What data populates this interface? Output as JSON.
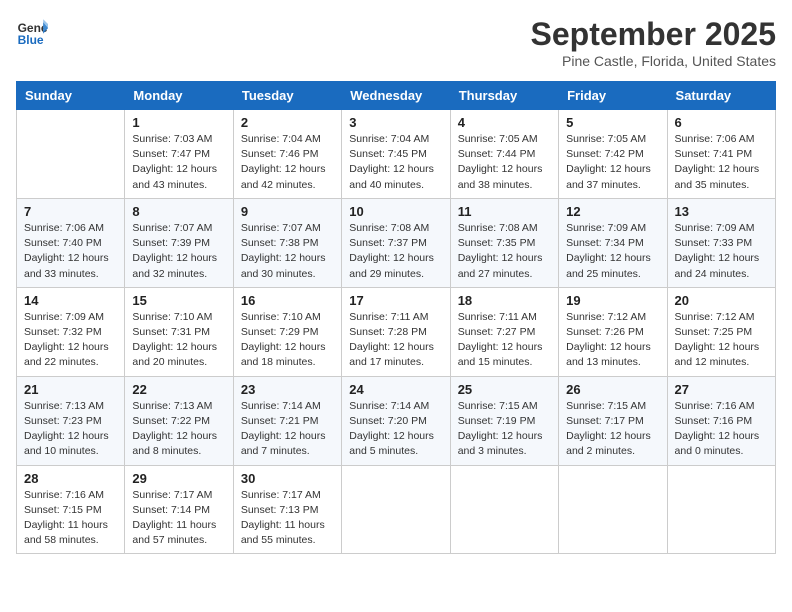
{
  "header": {
    "logo_line1": "General",
    "logo_line2": "Blue",
    "month": "September 2025",
    "location": "Pine Castle, Florida, United States"
  },
  "weekdays": [
    "Sunday",
    "Monday",
    "Tuesday",
    "Wednesday",
    "Thursday",
    "Friday",
    "Saturday"
  ],
  "weeks": [
    [
      {
        "day": "",
        "info": ""
      },
      {
        "day": "1",
        "info": "Sunrise: 7:03 AM\nSunset: 7:47 PM\nDaylight: 12 hours\nand 43 minutes."
      },
      {
        "day": "2",
        "info": "Sunrise: 7:04 AM\nSunset: 7:46 PM\nDaylight: 12 hours\nand 42 minutes."
      },
      {
        "day": "3",
        "info": "Sunrise: 7:04 AM\nSunset: 7:45 PM\nDaylight: 12 hours\nand 40 minutes."
      },
      {
        "day": "4",
        "info": "Sunrise: 7:05 AM\nSunset: 7:44 PM\nDaylight: 12 hours\nand 38 minutes."
      },
      {
        "day": "5",
        "info": "Sunrise: 7:05 AM\nSunset: 7:42 PM\nDaylight: 12 hours\nand 37 minutes."
      },
      {
        "day": "6",
        "info": "Sunrise: 7:06 AM\nSunset: 7:41 PM\nDaylight: 12 hours\nand 35 minutes."
      }
    ],
    [
      {
        "day": "7",
        "info": "Sunrise: 7:06 AM\nSunset: 7:40 PM\nDaylight: 12 hours\nand 33 minutes."
      },
      {
        "day": "8",
        "info": "Sunrise: 7:07 AM\nSunset: 7:39 PM\nDaylight: 12 hours\nand 32 minutes."
      },
      {
        "day": "9",
        "info": "Sunrise: 7:07 AM\nSunset: 7:38 PM\nDaylight: 12 hours\nand 30 minutes."
      },
      {
        "day": "10",
        "info": "Sunrise: 7:08 AM\nSunset: 7:37 PM\nDaylight: 12 hours\nand 29 minutes."
      },
      {
        "day": "11",
        "info": "Sunrise: 7:08 AM\nSunset: 7:35 PM\nDaylight: 12 hours\nand 27 minutes."
      },
      {
        "day": "12",
        "info": "Sunrise: 7:09 AM\nSunset: 7:34 PM\nDaylight: 12 hours\nand 25 minutes."
      },
      {
        "day": "13",
        "info": "Sunrise: 7:09 AM\nSunset: 7:33 PM\nDaylight: 12 hours\nand 24 minutes."
      }
    ],
    [
      {
        "day": "14",
        "info": "Sunrise: 7:09 AM\nSunset: 7:32 PM\nDaylight: 12 hours\nand 22 minutes."
      },
      {
        "day": "15",
        "info": "Sunrise: 7:10 AM\nSunset: 7:31 PM\nDaylight: 12 hours\nand 20 minutes."
      },
      {
        "day": "16",
        "info": "Sunrise: 7:10 AM\nSunset: 7:29 PM\nDaylight: 12 hours\nand 18 minutes."
      },
      {
        "day": "17",
        "info": "Sunrise: 7:11 AM\nSunset: 7:28 PM\nDaylight: 12 hours\nand 17 minutes."
      },
      {
        "day": "18",
        "info": "Sunrise: 7:11 AM\nSunset: 7:27 PM\nDaylight: 12 hours\nand 15 minutes."
      },
      {
        "day": "19",
        "info": "Sunrise: 7:12 AM\nSunset: 7:26 PM\nDaylight: 12 hours\nand 13 minutes."
      },
      {
        "day": "20",
        "info": "Sunrise: 7:12 AM\nSunset: 7:25 PM\nDaylight: 12 hours\nand 12 minutes."
      }
    ],
    [
      {
        "day": "21",
        "info": "Sunrise: 7:13 AM\nSunset: 7:23 PM\nDaylight: 12 hours\nand 10 minutes."
      },
      {
        "day": "22",
        "info": "Sunrise: 7:13 AM\nSunset: 7:22 PM\nDaylight: 12 hours\nand 8 minutes."
      },
      {
        "day": "23",
        "info": "Sunrise: 7:14 AM\nSunset: 7:21 PM\nDaylight: 12 hours\nand 7 minutes."
      },
      {
        "day": "24",
        "info": "Sunrise: 7:14 AM\nSunset: 7:20 PM\nDaylight: 12 hours\nand 5 minutes."
      },
      {
        "day": "25",
        "info": "Sunrise: 7:15 AM\nSunset: 7:19 PM\nDaylight: 12 hours\nand 3 minutes."
      },
      {
        "day": "26",
        "info": "Sunrise: 7:15 AM\nSunset: 7:17 PM\nDaylight: 12 hours\nand 2 minutes."
      },
      {
        "day": "27",
        "info": "Sunrise: 7:16 AM\nSunset: 7:16 PM\nDaylight: 12 hours\nand 0 minutes."
      }
    ],
    [
      {
        "day": "28",
        "info": "Sunrise: 7:16 AM\nSunset: 7:15 PM\nDaylight: 11 hours\nand 58 minutes."
      },
      {
        "day": "29",
        "info": "Sunrise: 7:17 AM\nSunset: 7:14 PM\nDaylight: 11 hours\nand 57 minutes."
      },
      {
        "day": "30",
        "info": "Sunrise: 7:17 AM\nSunset: 7:13 PM\nDaylight: 11 hours\nand 55 minutes."
      },
      {
        "day": "",
        "info": ""
      },
      {
        "day": "",
        "info": ""
      },
      {
        "day": "",
        "info": ""
      },
      {
        "day": "",
        "info": ""
      }
    ]
  ]
}
